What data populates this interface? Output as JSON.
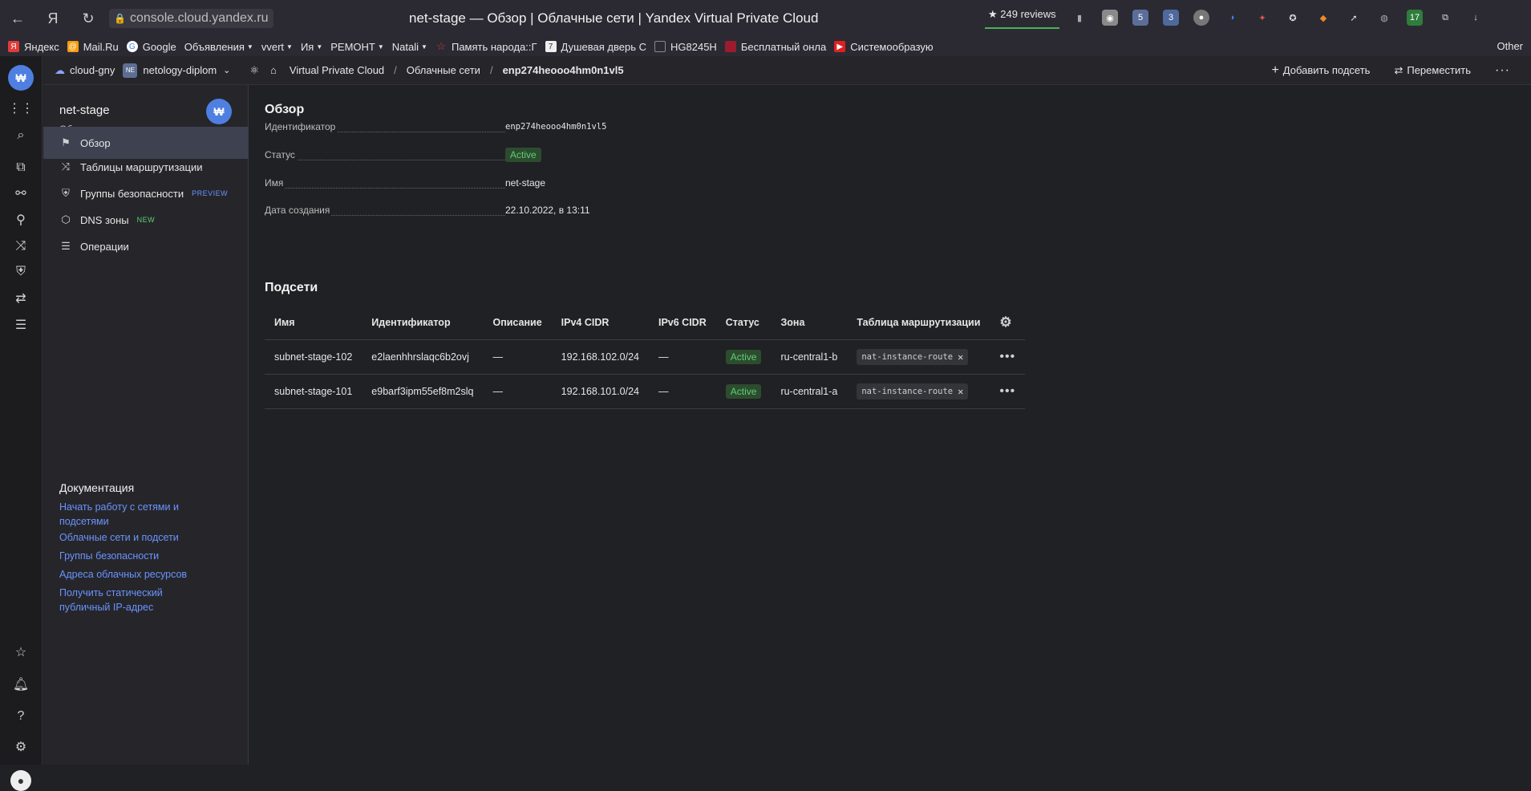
{
  "browser": {
    "url": "console.cloud.yandex.ru",
    "title": "net-stage — Обзор | Облачные сети | Yandex Virtual Private Cloud",
    "reviews": "249 reviews",
    "ext_badges": [
      "5",
      "3",
      "17"
    ],
    "bookmarks": [
      "Яндекс",
      "Mail.Ru",
      "Google",
      "Объявления",
      "vvert",
      "Ия",
      "РЕМОНТ",
      "Natali",
      "Память народа::Г",
      "Душевая дверь С",
      "HG8245H",
      "Бесплатный онла",
      "Системообразую"
    ],
    "other_label": "Other"
  },
  "topbar": {
    "cloud": "cloud-gny",
    "folder_badge": "NE",
    "folder": "netology-diplom",
    "crumbs": [
      "Virtual Private Cloud",
      "/",
      "Облачные сети",
      "/",
      "enp274heooo4hm0n1vl5"
    ],
    "add_subnet": "Добавить подсеть",
    "move": "Переместить"
  },
  "sidebar": {
    "title": "net-stage",
    "subtitle": "Облачная сеть",
    "items": [
      {
        "label": "Обзор"
      },
      {
        "label": "Таблицы маршрутизации"
      },
      {
        "label": "Группы безопасности",
        "tag": "PREVIEW"
      },
      {
        "label": "DNS зоны",
        "tag": "NEW"
      },
      {
        "label": "Операции"
      }
    ],
    "docs_title": "Документация",
    "docs": [
      "Начать работу с сетями и подсетями",
      "Облачные сети и подсети",
      "Группы безопасности",
      "Адреса облачных ресурсов",
      "Получить статический публичный IP-адрес"
    ]
  },
  "overview": {
    "title": "Обзор",
    "fields": [
      {
        "label": "Идентификатор",
        "value": "enp274heooo4hm0n1vl5"
      },
      {
        "label": "Статус",
        "value": "Active"
      },
      {
        "label": "Имя",
        "value": "net-stage"
      },
      {
        "label": "Дата создания",
        "value": "22.10.2022, в 13:11"
      }
    ]
  },
  "subnets": {
    "title": "Подсети",
    "columns": [
      "Имя",
      "Идентификатор",
      "Описание",
      "IPv4 CIDR",
      "IPv6 CIDR",
      "Статус",
      "Зона",
      "Таблица маршрутизации"
    ],
    "rows": [
      {
        "name": "subnet-stage-102",
        "id": "e2laenhhrslaqc6b2ovj",
        "desc": "—",
        "ipv4": "192.168.102.0/24",
        "ipv6": "—",
        "status": "Active",
        "zone": "ru-central1-b",
        "route": "nat-instance-route"
      },
      {
        "name": "subnet-stage-101",
        "id": "e9barf3ipm55ef8m2slq",
        "desc": "—",
        "ipv4": "192.168.101.0/24",
        "ipv6": "—",
        "status": "Active",
        "zone": "ru-central1-a",
        "route": "nat-instance-route"
      }
    ]
  }
}
